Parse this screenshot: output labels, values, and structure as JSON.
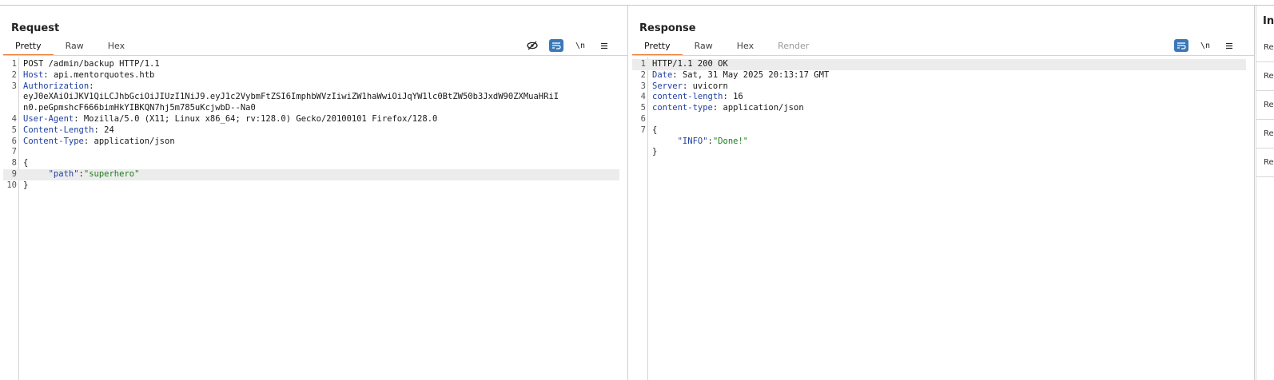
{
  "request": {
    "title": "Request",
    "tabs": [
      {
        "label": "Pretty",
        "active": true
      },
      {
        "label": "Raw",
        "active": false
      },
      {
        "label": "Hex",
        "active": false
      }
    ],
    "toolbar": {
      "hide_icon": "eye-slash-icon",
      "wrap_icon": "word-wrap-icon",
      "newline_label": "\\n",
      "menu_icon": "hamburger-menu-icon"
    },
    "lines": [
      {
        "num": "1",
        "parts": [
          {
            "t": "POST /admin/backup HTTP/1.1",
            "c": "plain"
          }
        ]
      },
      {
        "num": "2",
        "parts": [
          {
            "t": "Host",
            "c": "hdr"
          },
          {
            "t": ": api.mentorquotes.htb",
            "c": "plain"
          }
        ]
      },
      {
        "num": "3",
        "parts": [
          {
            "t": "Authorization",
            "c": "hdr"
          },
          {
            "t": ":",
            "c": "plain"
          }
        ]
      },
      {
        "num": "",
        "parts": [
          {
            "t": "eyJ0eXAiOiJKV1QiLCJhbGciOiJIUzI1NiJ9.eyJ1c2VybmFtZSI6ImphbWVzIiwiZW1haWwiOiJqYW1lc0BtZW50b3JxdW90ZXMuaHRiI",
            "c": "plain"
          }
        ]
      },
      {
        "num": "",
        "parts": [
          {
            "t": "n0.peGpmshcF666bimHkYIBKQN7hj5m785uKcjwbD--Na0",
            "c": "plain"
          }
        ]
      },
      {
        "num": "4",
        "parts": [
          {
            "t": "User-Agent",
            "c": "hdr"
          },
          {
            "t": ": Mozilla/5.0 (X11; Linux x86_64; rv:128.0) Gecko/20100101 Firefox/128.0",
            "c": "plain"
          }
        ]
      },
      {
        "num": "5",
        "parts": [
          {
            "t": "Content-Length",
            "c": "hdr"
          },
          {
            "t": ": 24",
            "c": "plain"
          }
        ]
      },
      {
        "num": "6",
        "parts": [
          {
            "t": "Content-Type",
            "c": "hdr"
          },
          {
            "t": ": application/json",
            "c": "plain"
          }
        ]
      },
      {
        "num": "7",
        "parts": []
      },
      {
        "num": "8",
        "parts": [
          {
            "t": "{",
            "c": "plain"
          }
        ]
      },
      {
        "num": "9",
        "highlight": true,
        "parts": [
          {
            "t": "     ",
            "c": "plain"
          },
          {
            "t": "\"path\"",
            "c": "key"
          },
          {
            "t": ":",
            "c": "plain"
          },
          {
            "t": "\"superhero\"",
            "c": "str"
          }
        ]
      },
      {
        "num": "10",
        "parts": [
          {
            "t": "}",
            "c": "plain"
          }
        ]
      }
    ]
  },
  "response": {
    "title": "Response",
    "tabs": [
      {
        "label": "Pretty",
        "active": true
      },
      {
        "label": "Raw",
        "active": false
      },
      {
        "label": "Hex",
        "active": false
      },
      {
        "label": "Render",
        "active": false,
        "disabled": true
      }
    ],
    "toolbar": {
      "wrap_icon": "word-wrap-icon",
      "newline_label": "\\n",
      "menu_icon": "hamburger-menu-icon"
    },
    "lines": [
      {
        "num": "1",
        "highlight": true,
        "parts": [
          {
            "t": "HTTP/1.1 200 OK",
            "c": "plain"
          }
        ]
      },
      {
        "num": "2",
        "parts": [
          {
            "t": "Date",
            "c": "hdr"
          },
          {
            "t": ": Sat, 31 May 2025 20:13:17 GMT",
            "c": "plain"
          }
        ]
      },
      {
        "num": "3",
        "parts": [
          {
            "t": "Server",
            "c": "hdr"
          },
          {
            "t": ": uvicorn",
            "c": "plain"
          }
        ]
      },
      {
        "num": "4",
        "parts": [
          {
            "t": "content-length",
            "c": "hdr"
          },
          {
            "t": ": 16",
            "c": "plain"
          }
        ]
      },
      {
        "num": "5",
        "parts": [
          {
            "t": "content-type",
            "c": "hdr"
          },
          {
            "t": ": application/json",
            "c": "plain"
          }
        ]
      },
      {
        "num": "6",
        "parts": []
      },
      {
        "num": "7",
        "parts": [
          {
            "t": "{",
            "c": "plain"
          }
        ]
      },
      {
        "num": "",
        "parts": [
          {
            "t": "     ",
            "c": "plain"
          },
          {
            "t": "\"INFO\"",
            "c": "key"
          },
          {
            "t": ":",
            "c": "plain"
          },
          {
            "t": "\"Done!\"",
            "c": "str"
          }
        ]
      },
      {
        "num": "",
        "parts": [
          {
            "t": "}",
            "c": "plain"
          }
        ]
      }
    ]
  },
  "layout_switch": {
    "options": [
      "side-by-side-icon",
      "stacked-icon",
      "single-pane-icon"
    ],
    "selected": 0
  },
  "inspector": {
    "title": "In",
    "items": [
      "Re",
      "Re",
      "Re",
      "Re",
      "Re"
    ]
  },
  "colors": {
    "accent_tab": "#e8742d",
    "selected_button": "#3a78b8",
    "header_name": "#1f3fa0",
    "json_string": "#1a7f1a"
  }
}
